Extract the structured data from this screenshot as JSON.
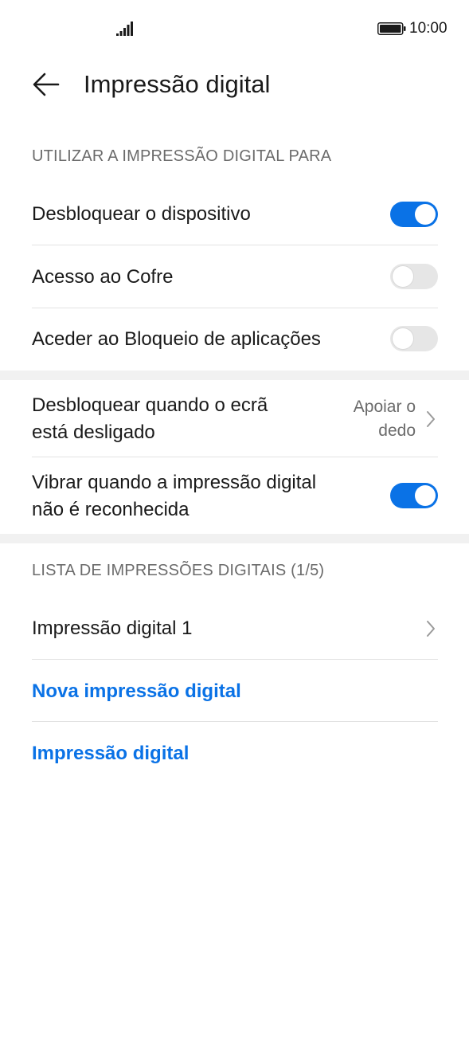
{
  "status_bar": {
    "time": "10:00",
    "signal_icon": "signal-icon",
    "battery_icon": "battery-icon"
  },
  "header": {
    "back_icon": "arrow-left-icon",
    "title": "Impressão digital"
  },
  "section_use": {
    "title": "UTILIZAR A IMPRESSÃO DIGITAL PARA",
    "items": [
      {
        "label": "Desbloquear o dispositivo",
        "enabled": true
      },
      {
        "label": "Acesso ao Cofre",
        "enabled": false
      },
      {
        "label": "Aceder ao Bloqueio de aplicações",
        "enabled": false
      }
    ]
  },
  "section_options": {
    "screen_off": {
      "label_line1": "Desbloquear quando o ecrã",
      "label_line2": "está desligado",
      "value_line1": "Apoiar o",
      "value_line2": "dedo"
    },
    "vibrate": {
      "label_line1": "Vibrar quando a impressão digital",
      "label_line2": "não é reconhecida",
      "enabled": true
    }
  },
  "section_list": {
    "title": "LISTA DE IMPRESSÕES DIGITAIS (1/5)",
    "fingerprint_item": "Impressão digital 1",
    "new_fingerprint": "Nova impressão digital",
    "fingerprint_link": "Impressão digital"
  },
  "colors": {
    "accent": "#0a72e6",
    "toggle_off": "#e6e6e6",
    "secondary_text": "#6b6b6b"
  }
}
